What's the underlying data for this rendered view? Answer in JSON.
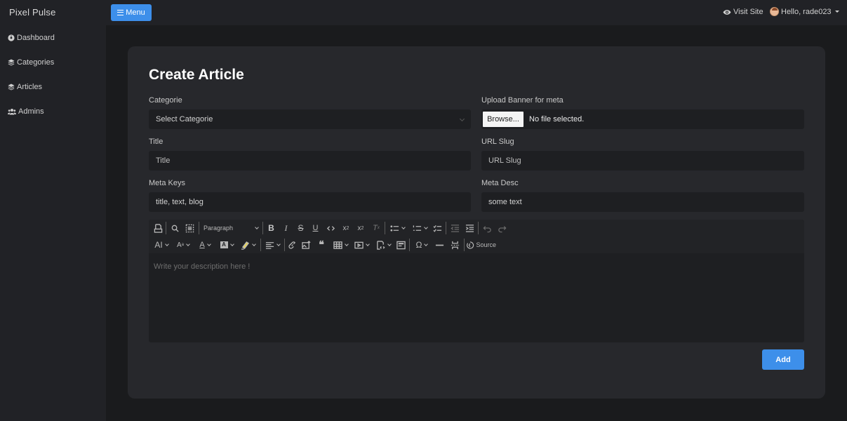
{
  "sidebar": {
    "brand": "Pixel Pulse",
    "items": [
      {
        "label": "Dashboard",
        "icon": "dashboard-icon"
      },
      {
        "label": "Categories",
        "icon": "layers-icon"
      },
      {
        "label": "Articles",
        "icon": "layers-icon"
      },
      {
        "label": "Admins",
        "icon": "users-icon"
      }
    ]
  },
  "topbar": {
    "menu_label": "Menu",
    "visit_label": "Visit Site",
    "user_label": "Hello, rade023"
  },
  "form": {
    "title": "Create Article",
    "categorie_label": "Categorie",
    "categorie_value": "Select Categorie",
    "banner_label": "Upload Banner for meta",
    "browse_label": "Browse...",
    "file_status": "No file selected.",
    "title_label": "Title",
    "title_placeholder": "Title",
    "slug_label": "URL Slug",
    "slug_placeholder": "URL Slug",
    "meta_keys_label": "Meta Keys",
    "meta_keys_value": "title, text, blog",
    "meta_desc_label": "Meta Desc",
    "meta_desc_value": "some text",
    "add_label": "Add"
  },
  "editor": {
    "heading_select": "Paragraph",
    "source_label": "Source",
    "placeholder": "Write your description here !"
  },
  "colors": {
    "accent": "#3d8fea",
    "card": "#27282c",
    "sidebar": "#212226",
    "field": "#1e1f22"
  }
}
